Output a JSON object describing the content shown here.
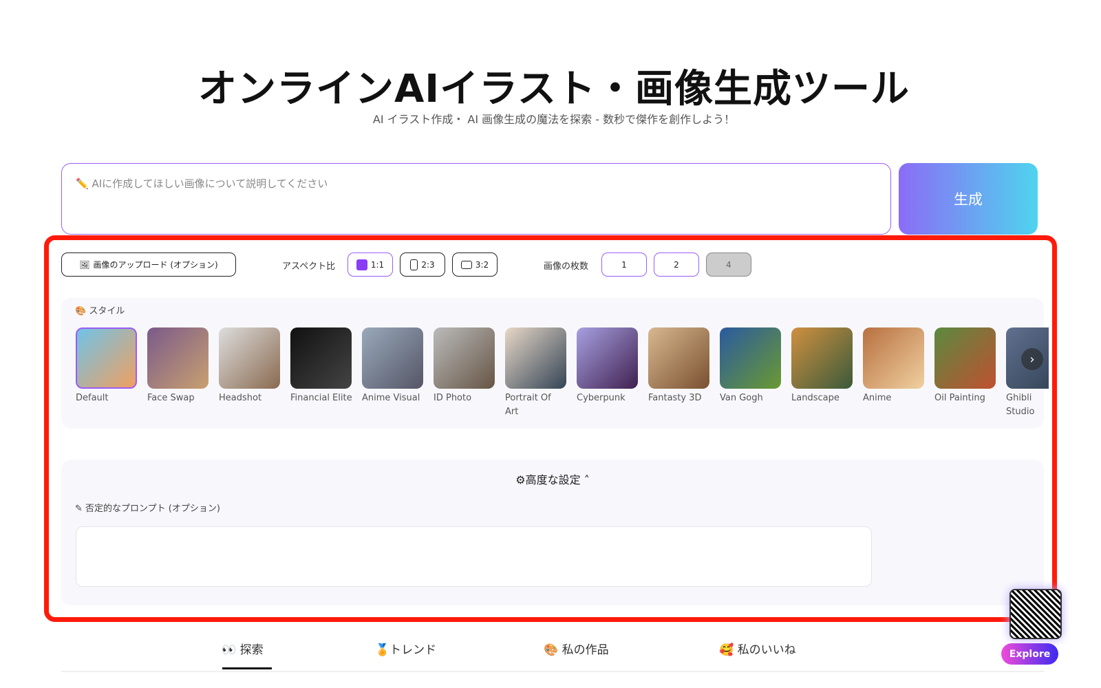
{
  "header": {
    "title": "オンラインAIイラスト・画像生成ツール",
    "subtitle": "AI イラスト作成・ AI 画像生成の魔法を探索 - 数秒で傑作を創作しよう！"
  },
  "prompt": {
    "icon": "pencil-icon",
    "placeholder": "✏️  AIに作成してほしい画像について説明してください",
    "generate_label": "生成"
  },
  "options": {
    "upload_label": "画像のアップロード (オプション)",
    "aspect_label": "アスペクト比",
    "aspect_options": [
      "1:1",
      "2:3",
      "3:2"
    ],
    "aspect_selected": "1:1",
    "count_label": "画像の枚数",
    "count_options": [
      "1",
      "2",
      "4"
    ]
  },
  "styles": {
    "label": "スタイル",
    "items": [
      "Default",
      "Face Swap",
      "Headshot",
      "Financial Elite",
      "Anime Visual",
      "ID Photo",
      "Portrait Of Art",
      "Cyberpunk",
      "Fantasty 3D",
      "Van Gogh",
      "Landscape",
      "Anime",
      "Oil Painting",
      "Ghibli Studio"
    ],
    "selected": "Default"
  },
  "advanced": {
    "label": "高度な設定",
    "negative_label": "否定的なプロンプト (オプション)",
    "negative_value": ""
  },
  "tabs": [
    {
      "label": "👀 探索",
      "active": true
    },
    {
      "label": "🏅トレンド"
    },
    {
      "label": "🎨 私の作品"
    },
    {
      "label": "🥰 私のいいね"
    }
  ],
  "widget": {
    "explore_label": "Explore"
  },
  "colors": {
    "accent": "#9b5cf6",
    "highlight": "#ff1a0a"
  }
}
